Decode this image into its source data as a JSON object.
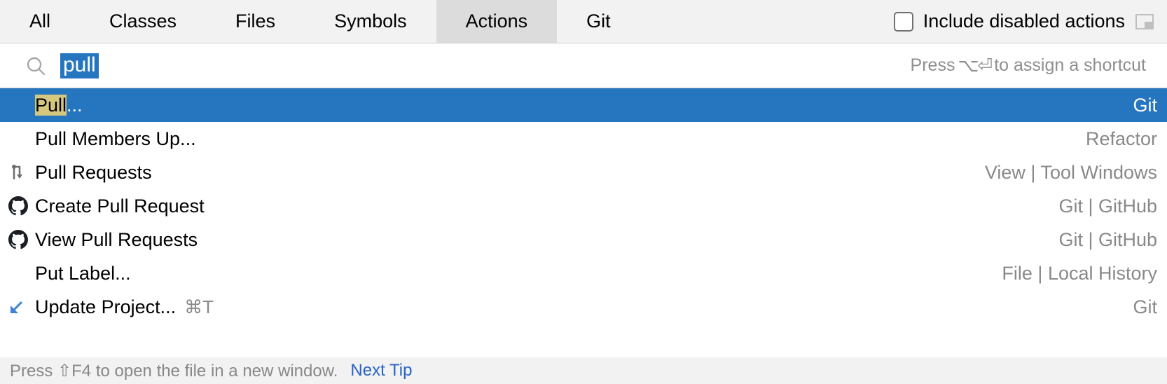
{
  "tabs": [
    {
      "label": "All",
      "active": false
    },
    {
      "label": "Classes",
      "active": false
    },
    {
      "label": "Files",
      "active": false
    },
    {
      "label": "Symbols",
      "active": false
    },
    {
      "label": "Actions",
      "active": true
    },
    {
      "label": "Git",
      "active": false
    }
  ],
  "include_disabled": {
    "label": "Include disabled actions",
    "checked": false
  },
  "search": {
    "query": "pull",
    "hint_prefix": "Press",
    "hint_glyph": "⌥⏎",
    "hint_suffix": "to assign a shortcut"
  },
  "results": [
    {
      "icon": "none",
      "highlight": "Pull",
      "rest": "...",
      "shortcut": "",
      "category": "Git",
      "selected": true
    },
    {
      "icon": "none",
      "highlight": "",
      "rest": "Pull Members Up...",
      "shortcut": "",
      "category": "Refactor",
      "selected": false
    },
    {
      "icon": "pullrequests",
      "highlight": "",
      "rest": "Pull Requests",
      "shortcut": "",
      "category": "View | Tool Windows",
      "selected": false
    },
    {
      "icon": "github",
      "highlight": "",
      "rest": "Create Pull Request",
      "shortcut": "",
      "category": "Git | GitHub",
      "selected": false
    },
    {
      "icon": "github",
      "highlight": "",
      "rest": "View Pull Requests",
      "shortcut": "",
      "category": "Git | GitHub",
      "selected": false
    },
    {
      "icon": "none",
      "highlight": "",
      "rest": "Put Label...",
      "shortcut": "",
      "category": "File | Local History",
      "selected": false
    },
    {
      "icon": "update",
      "highlight": "",
      "rest": "Update Project...",
      "shortcut": "⌘T",
      "category": "Git",
      "selected": false
    }
  ],
  "footer": {
    "tip_prefix": "Press",
    "tip_glyph": "⇧F4",
    "tip_suffix": "to open the file in a new window.",
    "next_tip": "Next Tip"
  }
}
